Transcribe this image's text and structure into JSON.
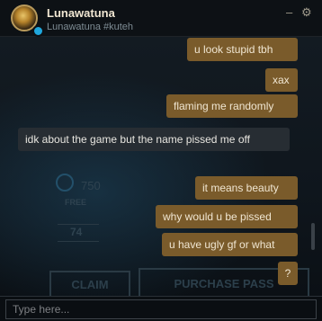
{
  "header": {
    "username": "Lunawatuna",
    "riot_id": "Lunawatuna #kuteh",
    "minimize_icon": "minimize-icon",
    "settings_icon": "gear-icon"
  },
  "background": {
    "price": "750",
    "free_label": "FREE",
    "level": "74",
    "claim_label": "CLAIM",
    "purchase_label": "PURCHASE PASS"
  },
  "messages": [
    {
      "text": "u look stupid tbh",
      "direction": "sent"
    },
    {
      "text": "xax",
      "direction": "sent"
    },
    {
      "text": "flaming me randomly",
      "direction": "sent"
    },
    {
      "text": "idk about the game but the name pissed me off",
      "direction": "received"
    },
    {
      "text": "it means beauty",
      "direction": "sent"
    },
    {
      "text": "why would u be pissed",
      "direction": "sent"
    },
    {
      "text": "u have ugly gf or what",
      "direction": "sent"
    },
    {
      "text": "?",
      "direction": "sent"
    }
  ],
  "input": {
    "placeholder": "Type here..."
  },
  "colors": {
    "sent_bubble": "#7a5b2b",
    "received_bubble": "#272d33",
    "accent_gold": "#cdbe91"
  }
}
